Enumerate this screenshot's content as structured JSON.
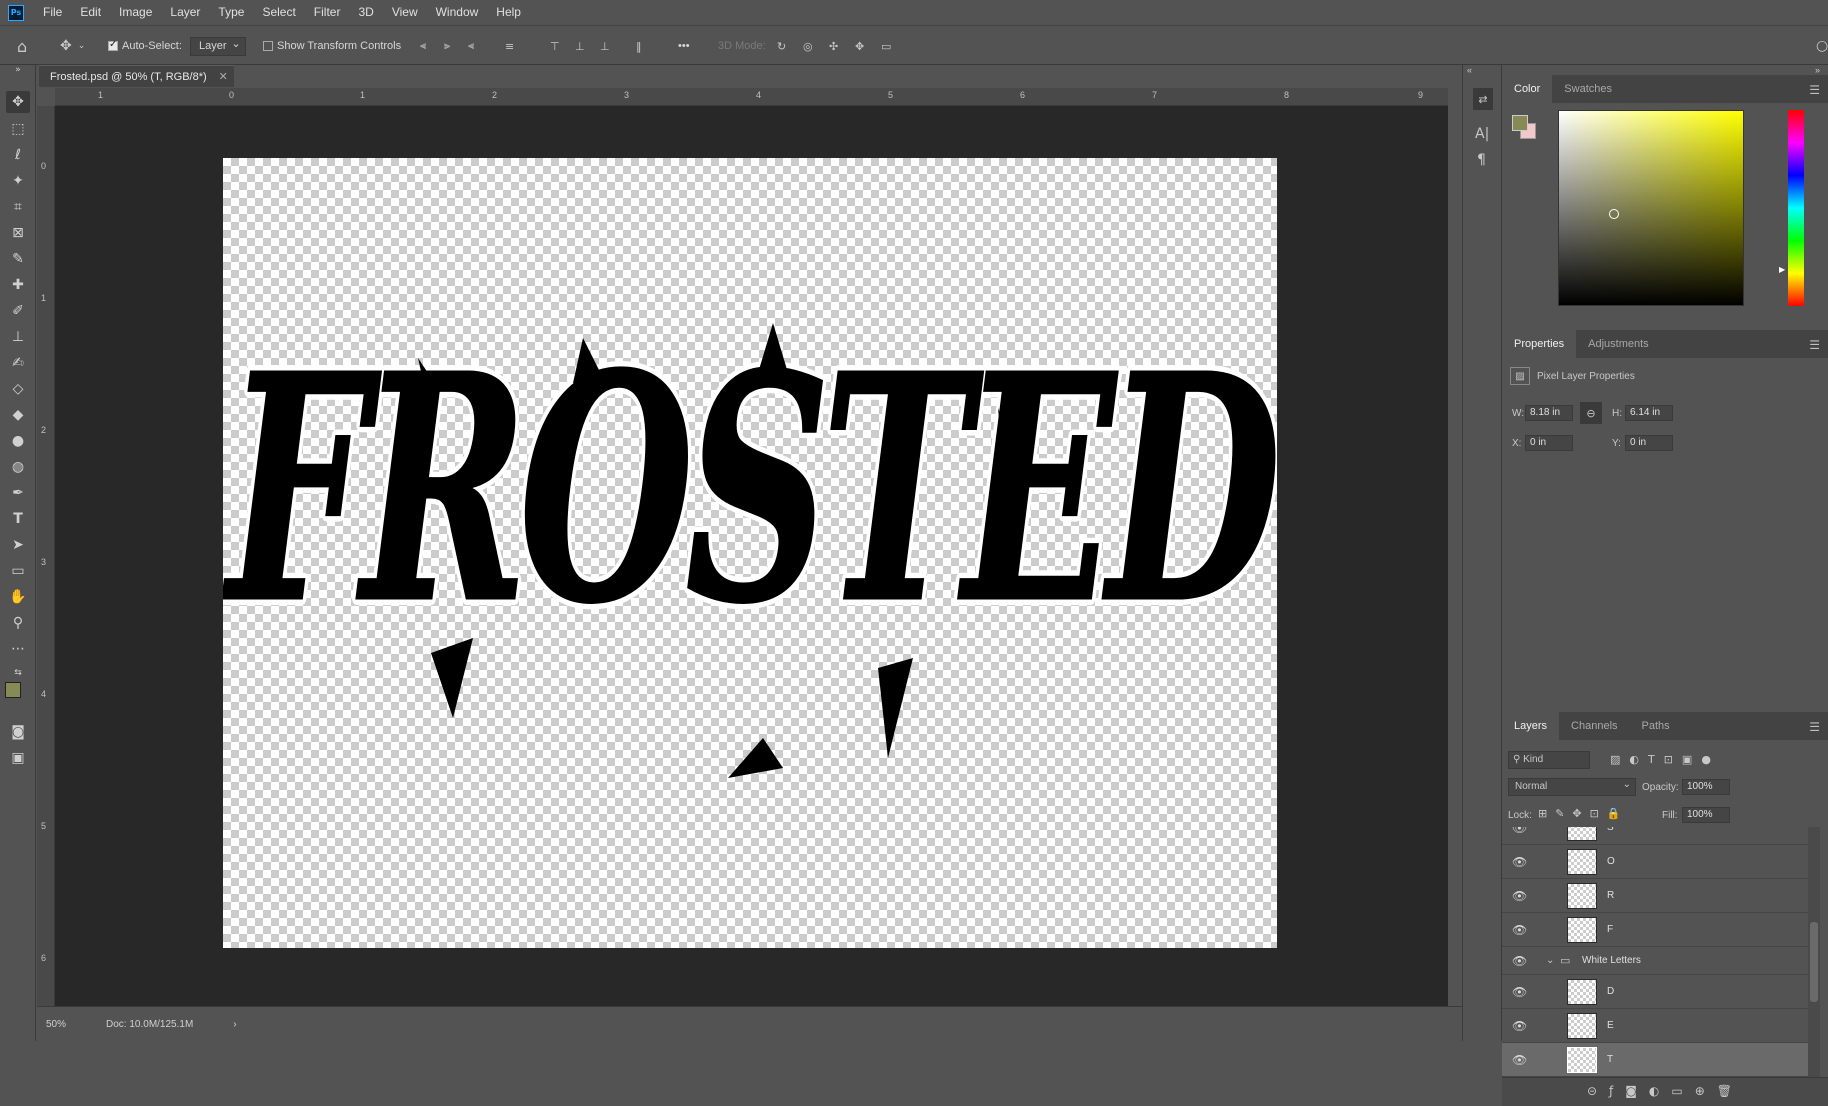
{
  "app": {
    "logo": "Ps"
  },
  "menu": [
    "File",
    "Edit",
    "Image",
    "Layer",
    "Type",
    "Select",
    "Filter",
    "3D",
    "View",
    "Window",
    "Help"
  ],
  "options": {
    "auto_select_label": "Auto-Select:",
    "auto_select_checked": true,
    "target_value": "Layer",
    "show_transform_label": "Show Transform Controls",
    "show_transform_checked": false,
    "mode_3d_label": "3D Mode:",
    "more": "•••"
  },
  "document": {
    "tab_title": "Frosted.psd @ 50% (T, RGB/8*)",
    "artwork_text": "FROSTED",
    "ruler_top": [
      "1",
      "0",
      "1",
      "2",
      "3",
      "4",
      "5",
      "6",
      "7",
      "8",
      "9"
    ],
    "ruler_left": [
      "0",
      "1",
      "2",
      "3",
      "4",
      "5",
      "6"
    ]
  },
  "status": {
    "zoom": "50%",
    "doc": "Doc: 10.0M/125.1M",
    "arrow": "›"
  },
  "colors": {
    "foreground": "#878a55",
    "background": "#f2c8c8",
    "accent": "#31a8ff"
  },
  "color_panel": {
    "tabs": [
      "Color",
      "Swatches"
    ]
  },
  "properties_panel": {
    "tabs": [
      "Properties",
      "Adjustments"
    ],
    "title": "Pixel Layer Properties",
    "w_label": "W:",
    "w_value": "8.18 in",
    "h_label": "H:",
    "h_value": "6.14 in",
    "x_label": "X:",
    "x_value": "0 in",
    "y_label": "Y:",
    "y_value": "0 in"
  },
  "layers_panel": {
    "tabs": [
      "Layers",
      "Channels",
      "Paths"
    ],
    "filter_value": "Kind",
    "blend_mode": "Normal",
    "opacity_label": "Opacity:",
    "opacity_value": "100%",
    "lock_label": "Lock:",
    "fill_label": "Fill:",
    "fill_value": "100%",
    "layers": [
      {
        "name": "S",
        "type": "pixel"
      },
      {
        "name": "O",
        "type": "pixel"
      },
      {
        "name": "R",
        "type": "pixel"
      },
      {
        "name": "F",
        "type": "pixel"
      },
      {
        "name": "White Letters",
        "type": "group"
      },
      {
        "name": "D",
        "type": "pixel"
      },
      {
        "name": "E",
        "type": "pixel"
      },
      {
        "name": "T",
        "type": "pixel",
        "selected": true
      }
    ]
  }
}
